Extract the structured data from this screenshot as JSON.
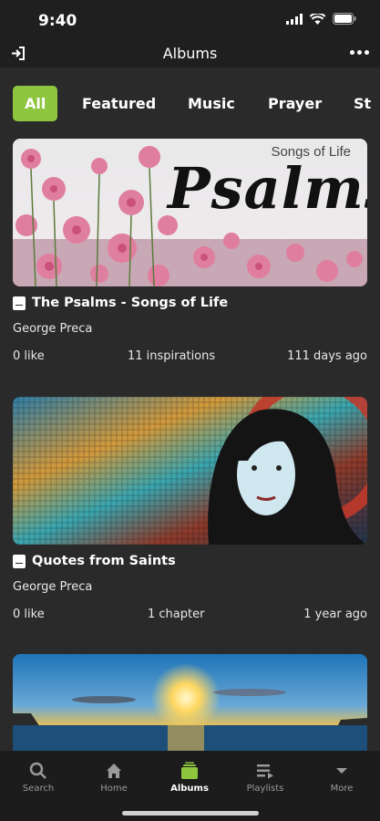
{
  "status": {
    "time": "9:40"
  },
  "header": {
    "title": "Albums"
  },
  "tabs": [
    {
      "label": "All",
      "active": true
    },
    {
      "label": "Featured",
      "active": false
    },
    {
      "label": "Music",
      "active": false
    },
    {
      "label": "Prayer",
      "active": false
    },
    {
      "label": "St",
      "active": false
    }
  ],
  "albums": [
    {
      "image_caption": "Songs of Life",
      "image_headline": "Psalms",
      "title": "The Psalms - Songs of Life",
      "author": "George Preca",
      "likes": "0 like",
      "count": "11 inspirations",
      "age": "111 days ago"
    },
    {
      "title": "Quotes from Saints",
      "author": "George Preca",
      "likes": "0 like",
      "count": "1 chapter",
      "age": "1 year ago"
    }
  ],
  "bottom_nav": [
    {
      "label": "Search",
      "icon": "search-icon"
    },
    {
      "label": "Home",
      "icon": "home-icon"
    },
    {
      "label": "Albums",
      "icon": "albums-icon",
      "active": true
    },
    {
      "label": "Playlists",
      "icon": "playlists-icon"
    },
    {
      "label": "More",
      "icon": "more-icon"
    }
  ],
  "colors": {
    "accent": "#8ec63f",
    "background": "#2a2a2a",
    "bar": "#1f1f1f"
  }
}
